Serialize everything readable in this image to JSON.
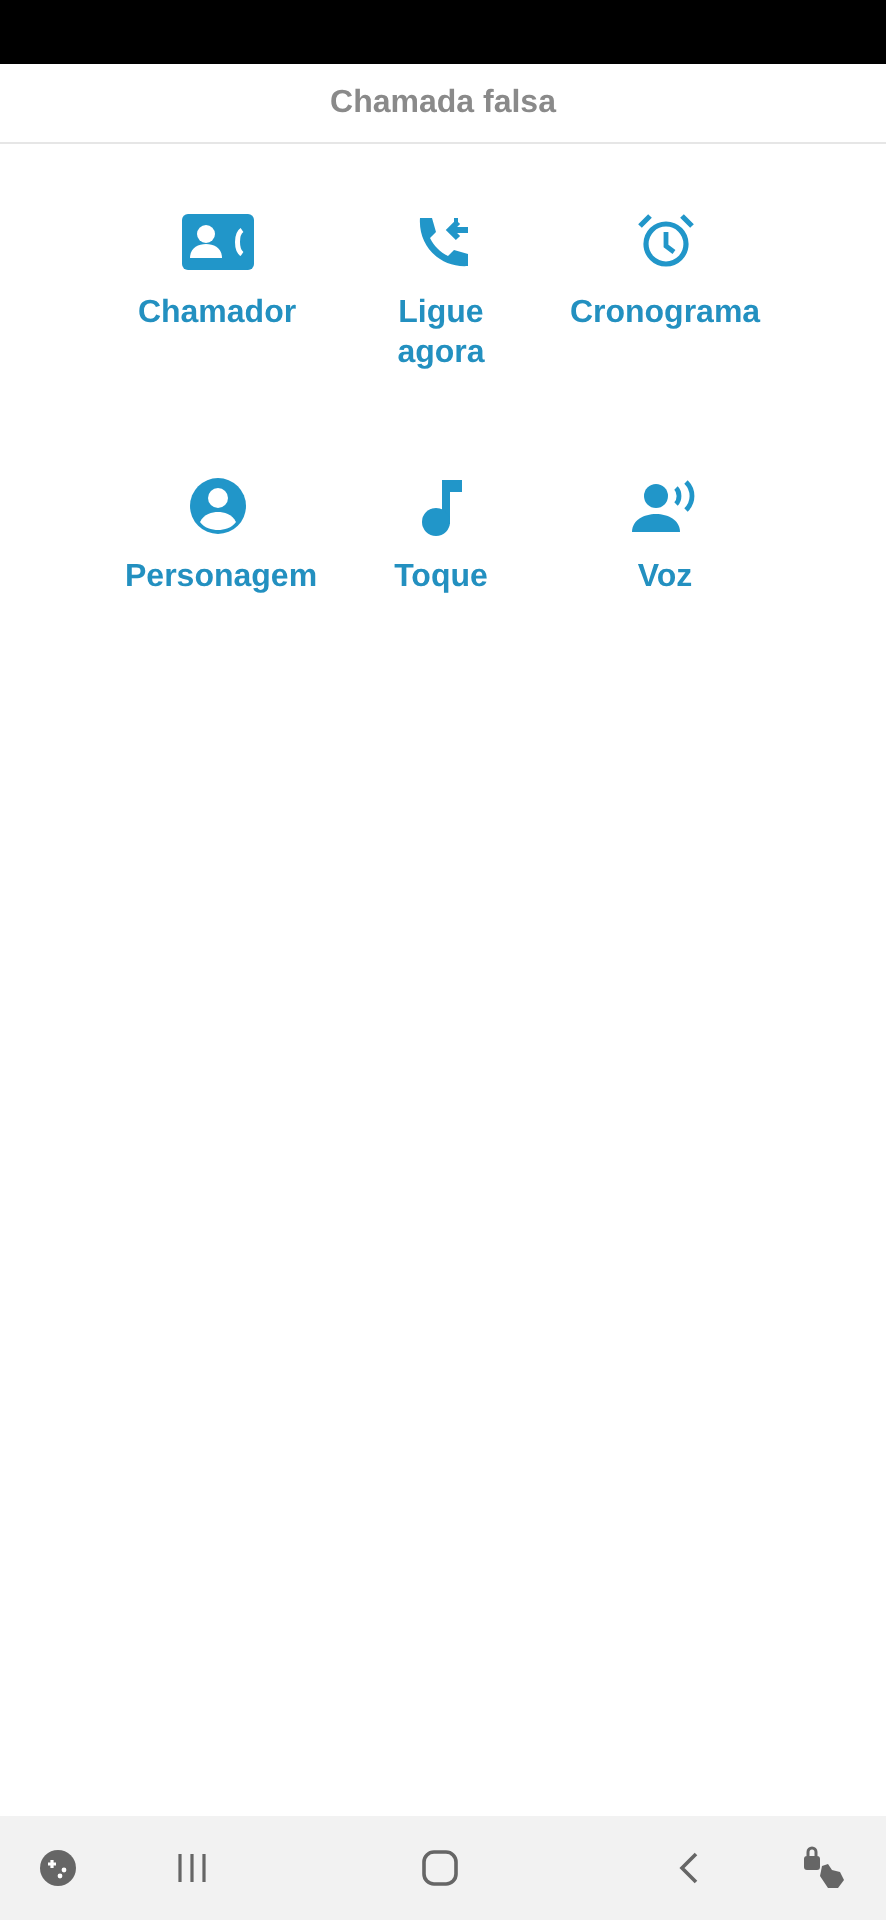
{
  "header": {
    "title": "Chamada falsa"
  },
  "items": [
    {
      "label": "Chamador",
      "kind": "contact"
    },
    {
      "label": "Ligue agora",
      "kind": "call"
    },
    {
      "label": "Cronograma",
      "kind": "alarm"
    },
    {
      "label": "Personagem",
      "kind": "person"
    },
    {
      "label": "Toque",
      "kind": "note"
    },
    {
      "label": "Voz",
      "kind": "voice"
    }
  ]
}
